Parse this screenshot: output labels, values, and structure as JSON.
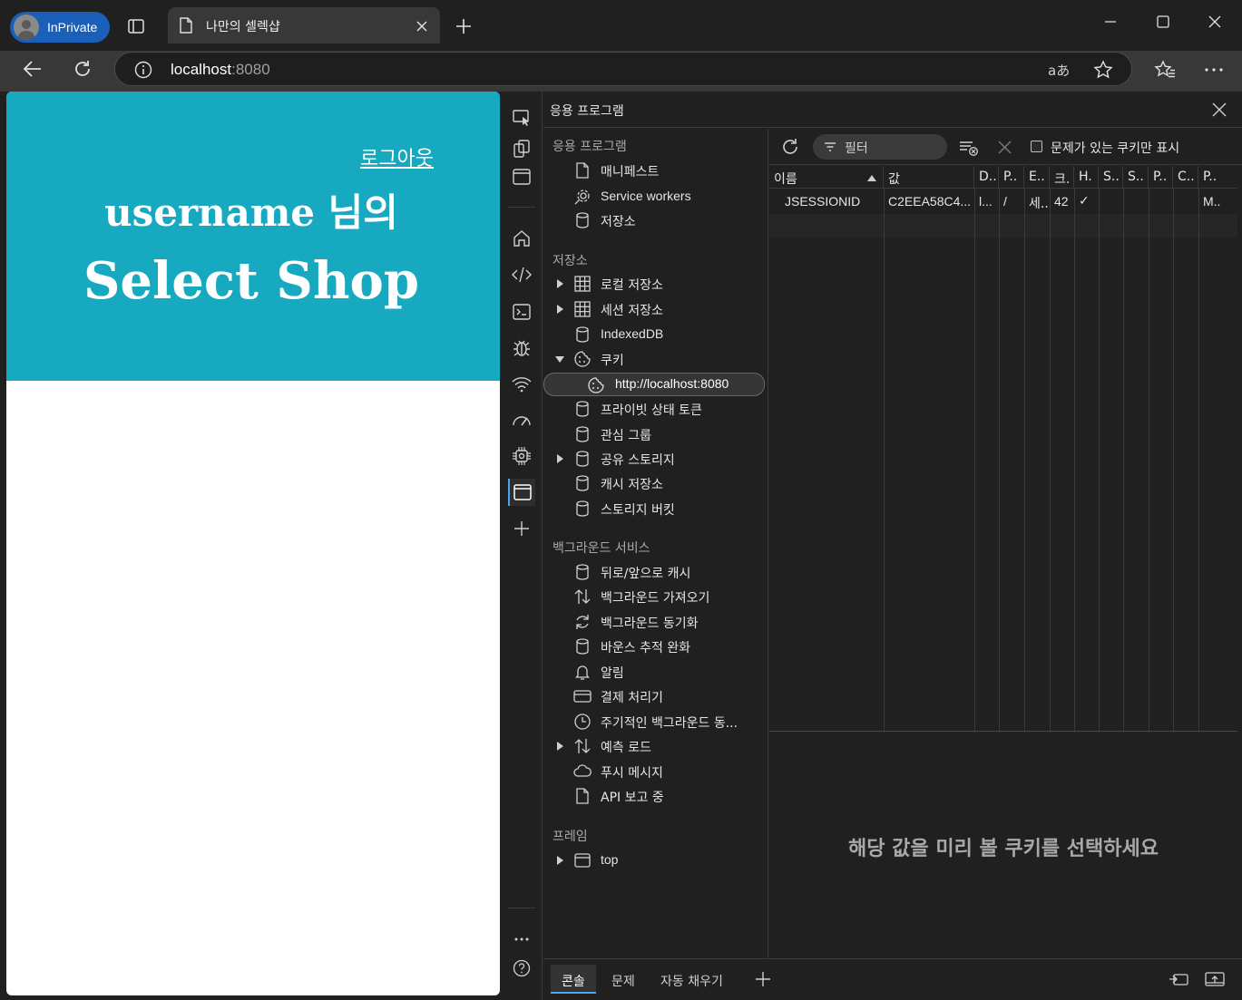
{
  "browser": {
    "inprivate_label": "InPrivate",
    "tab_title": "나만의 셀렉샵",
    "address": {
      "host": "localhost",
      "port": ":8080"
    },
    "icons": [
      "profile-avatar-icon",
      "tab-actions-icon",
      "page-icon",
      "close-tab-icon",
      "new-tab-icon",
      "minimize-icon",
      "maximize-icon",
      "close-window-icon",
      "back-icon",
      "refresh-icon",
      "site-info-icon",
      "read-aloud-icon",
      "favorite-star-icon",
      "favorites-icon",
      "more-icon"
    ]
  },
  "page": {
    "logout": "로그아웃",
    "greeting": "username 님의",
    "shop_name": "Select Shop",
    "banner_color": "#17a9c0"
  },
  "devtools": {
    "panel_title": "응용 프로그램",
    "sections": {
      "app": "응용 프로그램",
      "storage": "저장소",
      "background": "백그라운드 서비스",
      "frames": "프레임"
    },
    "app_items": [
      "매니페스트",
      "Service workers",
      "저장소"
    ],
    "storage_items": [
      "로컬 저장소",
      "세션 저장소",
      "IndexedDB",
      "쿠키",
      "http://localhost:8080",
      "프라이빗 상태 토큰",
      "관심 그룹",
      "공유 스토리지",
      "캐시 저장소",
      "스토리지 버킷"
    ],
    "background_items": [
      "뒤로/앞으로 캐시",
      "백그라운드 가져오기",
      "백그라운드 동기화",
      "바운스 추적 완화",
      "알림",
      "결제 처리기",
      "주기적인 백그라운드 동...",
      "예측 로드",
      "푸시 메시지",
      "API 보고 중"
    ],
    "frame_items": [
      "top"
    ],
    "toolbar": {
      "filter_placeholder": "필터",
      "only_issues_label": "문제가 있는 쿠키만 표시"
    },
    "columns": [
      "이름",
      "값",
      "D..",
      "P..",
      "E..",
      "크.",
      "H.",
      "S..",
      "S..",
      "P..",
      "C..",
      "P.."
    ],
    "rows": [
      {
        "name": "JSESSIONID",
        "value": "C2EEA58C4...",
        "domain": "l...",
        "path": "/",
        "expires": "세..",
        "size": "42",
        "http_only": "✓",
        "secure": "",
        "samesite": "",
        "partition": "",
        "cross_site": "",
        "priority": "M.."
      }
    ],
    "preview_message": "해당 값을 미리 볼 쿠키를 선택하세요",
    "drawer_tabs": [
      "콘솔",
      "문제",
      "자동 채우기"
    ],
    "accent_color": "#4aa5f0"
  }
}
